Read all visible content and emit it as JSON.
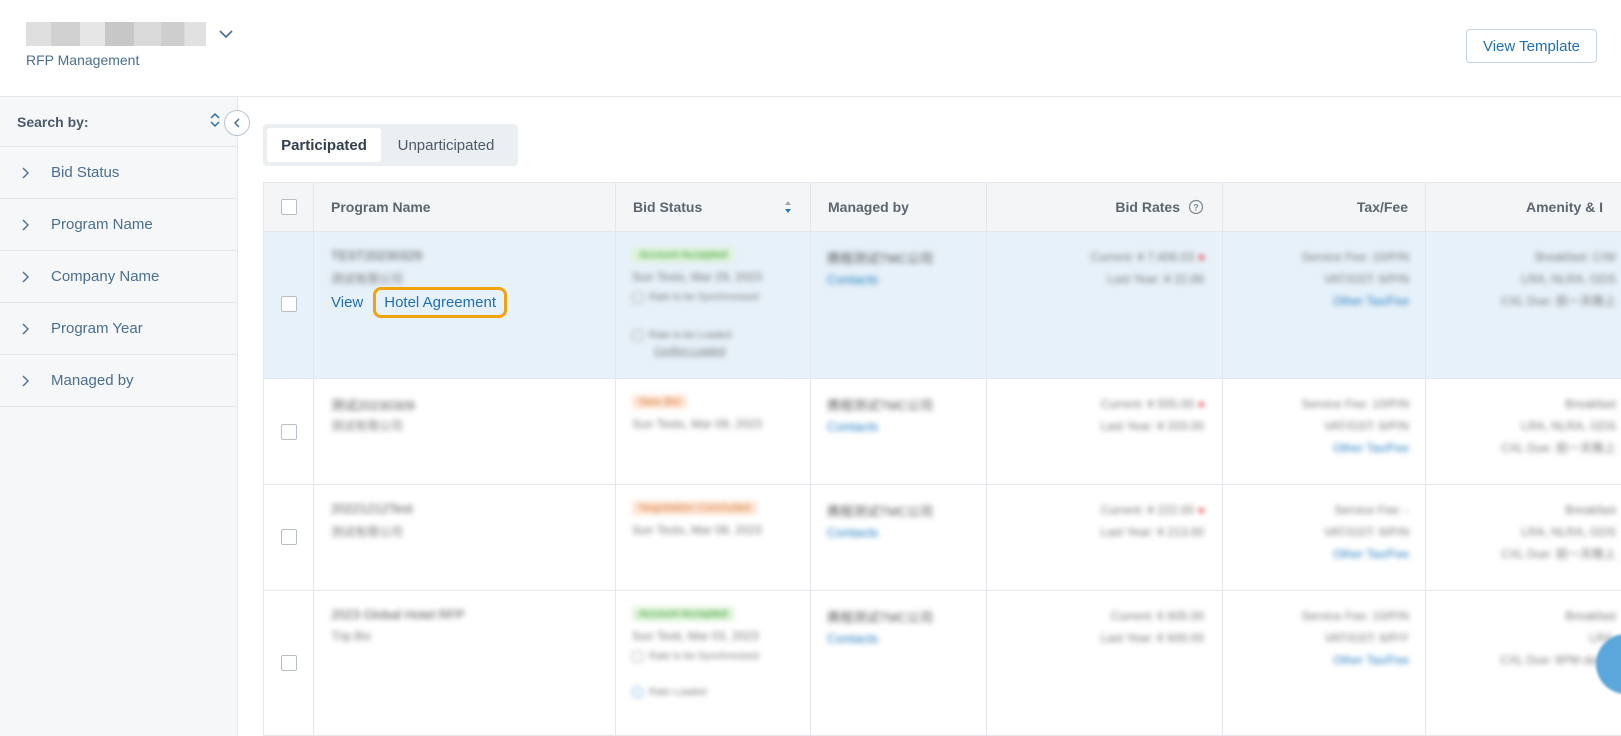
{
  "header": {
    "subtitle": "RFP Management",
    "view_template_label": "View Template"
  },
  "sidebar": {
    "search_by_label": "Search by:",
    "items": [
      {
        "label": "Bid Status"
      },
      {
        "label": "Program Name"
      },
      {
        "label": "Company Name"
      },
      {
        "label": "Program Year"
      },
      {
        "label": "Managed by"
      }
    ]
  },
  "tabs": [
    {
      "label": "Participated",
      "active": true
    },
    {
      "label": "Unparticipated",
      "active": false
    }
  ],
  "table": {
    "columns": [
      "Program Name",
      "Bid Status",
      "Managed by",
      "Bid Rates",
      "Tax/Fee",
      "Amenity & I"
    ],
    "rows": [
      {
        "program": "TEST20230329",
        "company": "测试有限公司",
        "status": "Account Accepted",
        "date": "Sun Tests, Mar 29, 2023",
        "sync_label": "Rate to be Synchronized",
        "load_label": "Rate to be Loaded",
        "confirm_label": "Confirm Loaded",
        "manager": "携程测试TMC公司",
        "contacts": "Contacts",
        "current": "Current: ¥ 7,406.03",
        "last_year": "Last Year: ¥ 22.86",
        "service_fee": "Service Fee: 10/P/N",
        "vat": "VAT/GST: 6/P/N",
        "other_tax": "Other Tax/Fee",
        "amenity_1": "Breakfast: C/W",
        "amenity_2": "LRA, NLRA, GDS",
        "amenity_3": "CXL Due: 前一天晚上",
        "view_label": "View",
        "hotel_agreement_label": "Hotel Agreement"
      },
      {
        "program": "测试20230309",
        "company": "测试有限公司",
        "status": "New Bid",
        "date": "Sun Tests, Mar 09, 2023",
        "manager": "携程测试TMC公司",
        "contacts": "Contacts",
        "current": "Current: ¥ 555.00",
        "last_year": "Last Year: ¥ 333.00",
        "service_fee": "Service Fee: 10/P/N",
        "vat": "VAT/GST: 6/P/N",
        "other_tax": "Other Tax/Fee",
        "amenity_1": "Breakfast",
        "amenity_2": "LRA, NLRA, GDS",
        "amenity_3": "CXL Due: 前一天晚上"
      },
      {
        "program": "20221212Test",
        "company": "测试有限公司",
        "status": "Negotiation Concluded",
        "date": "Sun Tests, Mar 08, 2023",
        "manager": "携程测试TMC公司",
        "contacts": "Contacts",
        "current": "Current: ¥ 222.00",
        "last_year": "Last Year: ¥ 213.00",
        "service_fee": "Service Fee: -",
        "vat": "VAT/GST: 6/P/N",
        "other_tax": "Other Tax/Fee",
        "amenity_1": "Breakfast",
        "amenity_2": "LRA, NLRA, GDS",
        "amenity_3": "CXL Due: 前一天晚上"
      },
      {
        "program": "2023 Global Hotel RFP",
        "company": "Trip.Biz",
        "status": "Account Accepted",
        "date": "Sun Testi, Mar 03, 2023",
        "sync_label": "Rate to be Synchronized",
        "load_label": "Rate Loaded",
        "manager": "携程测试TMC公司",
        "contacts": "Contacts",
        "current": "Current: € 605.00",
        "last_year": "Last Year: € 600.00",
        "service_fee": "Service Fee: 10/P/N",
        "vat": "VAT/GST: 6/P/Y",
        "other_tax": "Other Tax/Fee",
        "amenity_1": "Breakfast",
        "amenity_2": "LRA,",
        "amenity_3": "CXL Due: 6PM day of"
      }
    ]
  },
  "colors": {
    "accent": "#1f6fb0",
    "highlight_row": "#e7f1f9",
    "callout": "#f0a30a"
  }
}
